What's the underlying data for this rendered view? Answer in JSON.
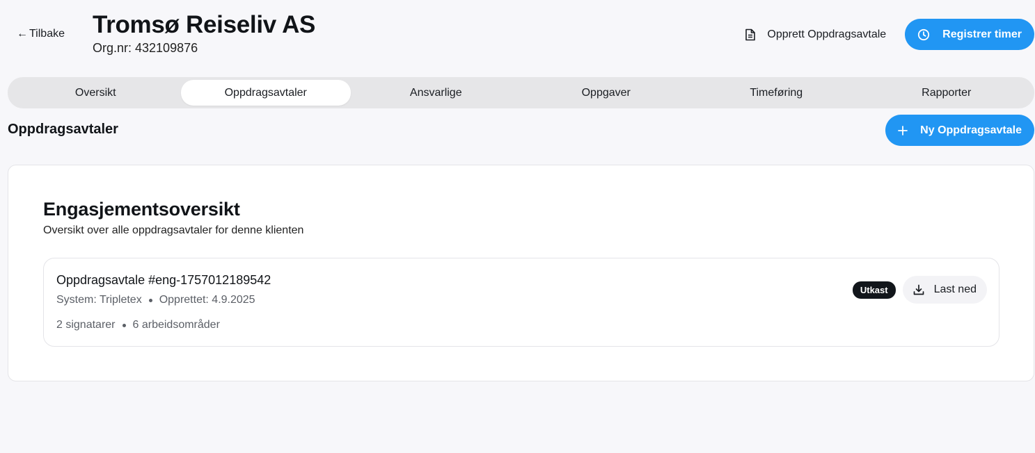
{
  "header": {
    "back_label": "Tilbake",
    "client_name": "Tromsø Reiseliv AS",
    "org_number": "Org.nr: 432109876",
    "create_agreement_label": "Opprett Oppdragsavtale",
    "register_time_label": "Registrer timer",
    "icons": {
      "back": "arrow-left-icon",
      "create": "document-icon",
      "register": "clock-icon"
    }
  },
  "tabs": [
    {
      "label": "Oversikt",
      "active": false
    },
    {
      "label": "Oppdragsavtaler",
      "active": true
    },
    {
      "label": "Ansvarlige",
      "active": false
    },
    {
      "label": "Oppgaver",
      "active": false
    },
    {
      "label": "Timeføring",
      "active": false
    },
    {
      "label": "Rapporter",
      "active": false
    }
  ],
  "section": {
    "title": "Oppdragsavtaler",
    "new_button_label": "Ny Oppdragsavtale",
    "new_button_icon": "plus-icon"
  },
  "card": {
    "title": "Engasjementsoversikt",
    "subtitle": "Oversikt over alle oppdragsavtaler for denne klienten",
    "engagements": [
      {
        "title": "Oppdragsavtale #eng-1757012189542",
        "system": "System: Tripletex",
        "created": "Opprettet: 4.9.2025",
        "signatories": "2 signatarer",
        "work_areas": "6 arbeidsområder",
        "status": "Utkast",
        "download_label": "Last ned",
        "download_icon": "download-icon"
      }
    ]
  },
  "colors": {
    "accent": "#2196f3",
    "background": "#f7f7fa",
    "badge": "#12161b"
  }
}
